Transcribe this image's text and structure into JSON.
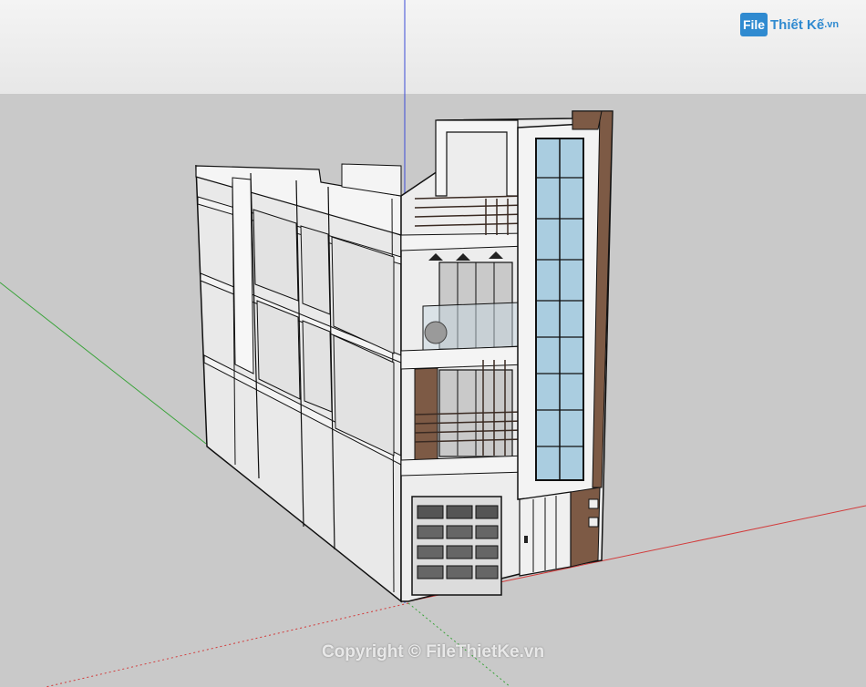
{
  "watermark": {
    "logo_badge": "File",
    "logo_text": "Thiết Kế",
    "logo_ext": ".vn",
    "copyright": "Copyright © FileThietKe.vn"
  },
  "colors": {
    "sky": "#eeeeee",
    "ground": "#c9c9c9",
    "wall": "#ececec",
    "window_glass": "#aacde0",
    "wood": "#7d5a45",
    "axis_red": "#d23b3b",
    "axis_green": "#3aa33a",
    "axis_blue": "#3b4bd6"
  }
}
